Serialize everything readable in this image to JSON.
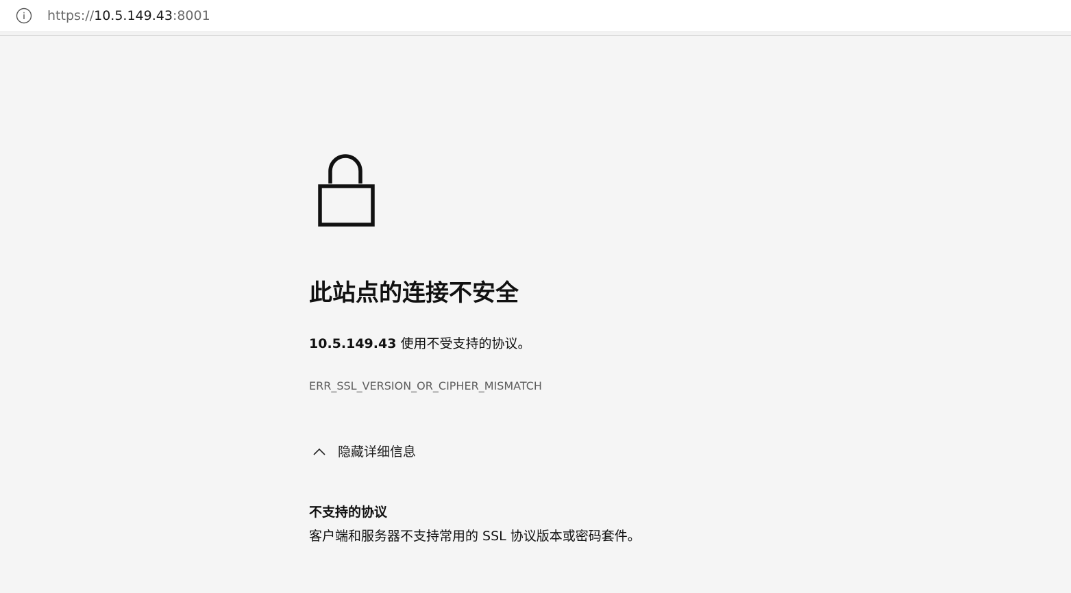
{
  "address_bar": {
    "icon": "info-icon",
    "url_scheme": "https://",
    "url_host": "10.5.149.43",
    "url_port": ":8001"
  },
  "error_page": {
    "icon": "unlocked-padlock-icon",
    "title": "此站点的连接不安全",
    "message_host": "10.5.149.43",
    "message_text": " 使用不受支持的协议。",
    "error_code": "ERR_SSL_VERSION_OR_CIPHER_MISMATCH",
    "details_toggle_label": "隐藏详细信息",
    "details_heading": "不支持的协议",
    "details_text": "客户端和服务器不支持常用的 SSL 协议版本或密码套件。"
  },
  "colors": {
    "page_background": "#f5f5f5",
    "address_bar_background": "#ffffff",
    "text_primary": "#111111",
    "text_secondary": "#5c5c5c"
  }
}
